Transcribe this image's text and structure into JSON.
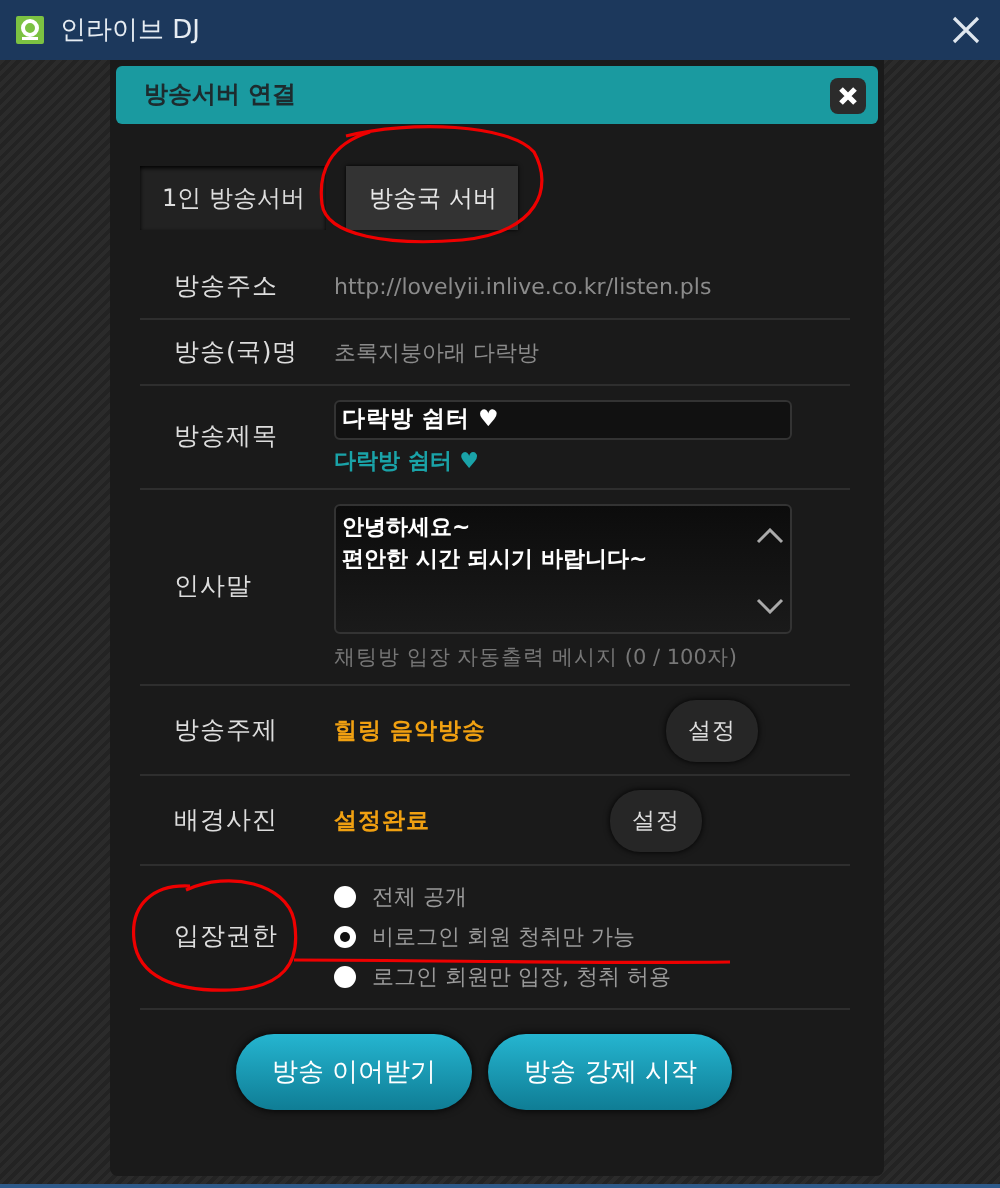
{
  "app": {
    "title": "인라이브 DJ"
  },
  "dialog": {
    "title": "방송서버 연결"
  },
  "tabs": [
    {
      "label": "1인 방송서버",
      "selected": false
    },
    {
      "label": "방송국 서버",
      "selected": true
    }
  ],
  "fields": [
    {
      "kind": "text",
      "label": "방송주소",
      "value": "http://lovelyii.inlive.co.kr/listen.pls"
    },
    {
      "kind": "text",
      "label": "방송(국)명",
      "value": "초록지붕아래 다락방"
    },
    {
      "kind": "title",
      "label": "방송제목",
      "value": "다락방 쉼터 ♥",
      "preview": "다락방 쉼터 ♥"
    },
    {
      "kind": "textarea",
      "label": "인사말",
      "value": "안녕하세요~\n편안한 시간 되시기 바랍니다~",
      "hint": "채팅방 입장 자동출력 메시지 (0 / 100자)"
    },
    {
      "kind": "setting",
      "label": "방송주제",
      "value": "힐링 음악방송",
      "button": "설정"
    },
    {
      "kind": "setting",
      "label": "배경사진",
      "value": "설정완료",
      "button": "설정"
    },
    {
      "kind": "radio",
      "label": "입장권한",
      "options": [
        {
          "label": "전체 공개",
          "selected": false
        },
        {
          "label": "비로그인 회원 청취만 가능",
          "selected": true
        },
        {
          "label": "로그인 회원만 입장, 청취 허용",
          "selected": false
        }
      ]
    }
  ],
  "buttons": [
    "방송 이어받기",
    "방송 강제 시작"
  ]
}
